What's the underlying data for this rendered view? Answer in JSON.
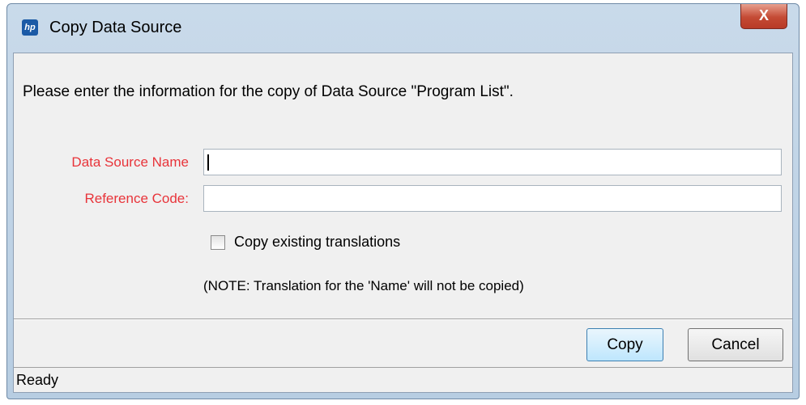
{
  "window": {
    "title": "Copy Data Source",
    "app_icon_text": "hp",
    "close_glyph": "X"
  },
  "form": {
    "prompt": "Please enter the information for the copy of Data Source \"Program List\".",
    "name_label": "Data Source Name",
    "name_value": "",
    "code_label": "Reference Code:",
    "code_value": "",
    "checkbox_label": "Copy existing translations",
    "checkbox_checked": false,
    "note": "(NOTE: Translation for the 'Name' will not be copied)"
  },
  "buttons": {
    "copy_label": "Copy",
    "cancel_label": "Cancel"
  },
  "status_bar": {
    "text": "Ready"
  },
  "colors": {
    "required_label": "#e8343a",
    "title_bar": "#c9daea",
    "client_bg": "#f0f0f0",
    "close_button": "#c44a34"
  }
}
